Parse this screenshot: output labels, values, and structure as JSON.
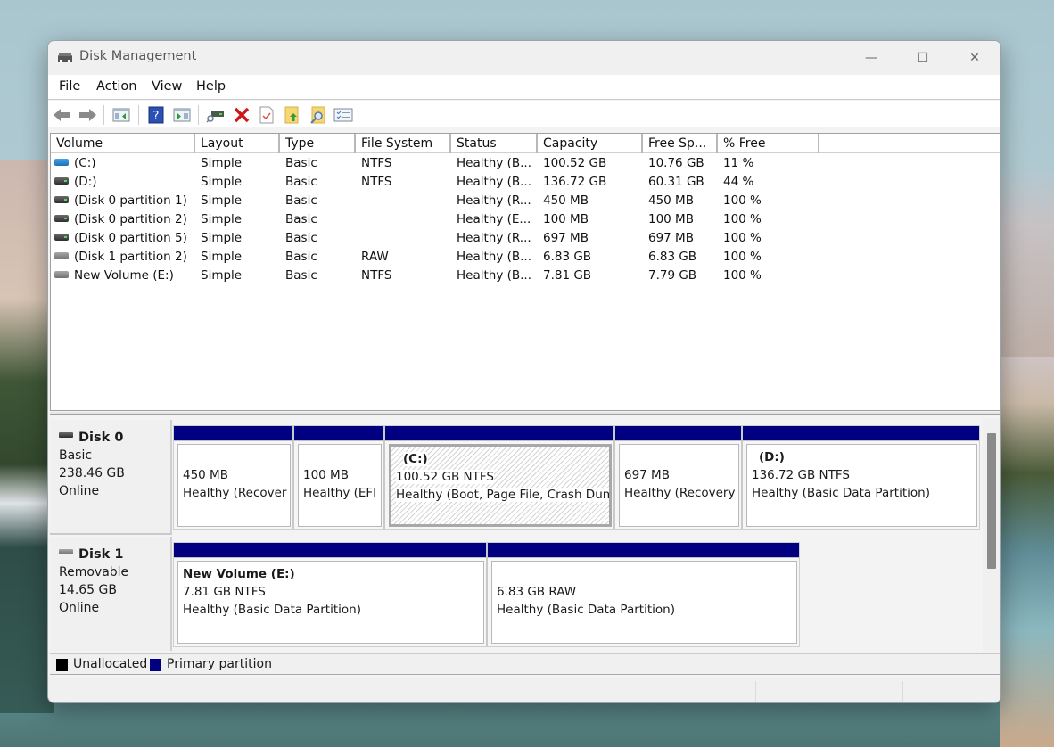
{
  "window": {
    "title": "Disk Management",
    "controls": {
      "minimize": "—",
      "maximize": "☐",
      "close": "✕"
    }
  },
  "menu": [
    "File",
    "Action",
    "View",
    "Help"
  ],
  "toolbar": [
    {
      "name": "back-icon"
    },
    {
      "name": "forward-icon"
    },
    {
      "name": "show-hide-console-tree-icon"
    },
    {
      "name": "help-icon"
    },
    {
      "name": "show-hide-action-pane-icon"
    },
    {
      "name": "connect-disk-icon"
    },
    {
      "name": "delete-icon"
    },
    {
      "name": "properties-icon"
    },
    {
      "name": "open-folder-up-icon"
    },
    {
      "name": "search-folder-icon"
    },
    {
      "name": "checklist-icon"
    }
  ],
  "volume_list": {
    "columns": [
      "Volume",
      "Layout",
      "Type",
      "File System",
      "Status",
      "Capacity",
      "Free Sp...",
      "% Free"
    ],
    "rows": [
      {
        "icon": "blue",
        "volume": " (C:)",
        "layout": "Simple",
        "type": "Basic",
        "fs": "NTFS",
        "status": "Healthy (B...",
        "capacity": "100.52 GB",
        "free": "10.76 GB",
        "pct": "11 %"
      },
      {
        "icon": "dark",
        "volume": " (D:)",
        "layout": "Simple",
        "type": "Basic",
        "fs": "NTFS",
        "status": "Healthy (B...",
        "capacity": "136.72 GB",
        "free": "60.31 GB",
        "pct": "44 %"
      },
      {
        "icon": "dark",
        "volume": "(Disk 0 partition 1)",
        "layout": "Simple",
        "type": "Basic",
        "fs": "",
        "status": "Healthy (R...",
        "capacity": "450 MB",
        "free": "450 MB",
        "pct": "100 %"
      },
      {
        "icon": "dark",
        "volume": "(Disk 0 partition 2)",
        "layout": "Simple",
        "type": "Basic",
        "fs": "",
        "status": "Healthy (E...",
        "capacity": "100 MB",
        "free": "100 MB",
        "pct": "100 %"
      },
      {
        "icon": "dark",
        "volume": "(Disk 0 partition 5)",
        "layout": "Simple",
        "type": "Basic",
        "fs": "",
        "status": "Healthy (R...",
        "capacity": "697 MB",
        "free": "697 MB",
        "pct": "100 %"
      },
      {
        "icon": "grey",
        "volume": "(Disk 1 partition 2)",
        "layout": "Simple",
        "type": "Basic",
        "fs": "RAW",
        "status": "Healthy (B...",
        "capacity": "6.83 GB",
        "free": "6.83 GB",
        "pct": "100 %"
      },
      {
        "icon": "grey",
        "volume": "New Volume (E:)",
        "layout": "Simple",
        "type": "Basic",
        "fs": "NTFS",
        "status": "Healthy (B...",
        "capacity": "7.81 GB",
        "free": "7.79 GB",
        "pct": "100 %"
      }
    ]
  },
  "disks": [
    {
      "name": "Disk 0",
      "kind": "Basic",
      "size": "238.46 GB",
      "state": "Online",
      "partitions": [
        {
          "title": "",
          "size": "450 MB",
          "status": "Healthy (Recover"
        },
        {
          "title": "",
          "size": "100 MB",
          "status": "Healthy (EFI"
        },
        {
          "title": "(C:)",
          "size": "100.52 GB NTFS",
          "status": "Healthy (Boot, Page File, Crash Dum"
        },
        {
          "title": "",
          "size": "697 MB",
          "status": "Healthy (Recovery"
        },
        {
          "title": "(D:)",
          "size": "136.72 GB NTFS",
          "status": "Healthy (Basic Data Partition)"
        }
      ]
    },
    {
      "name": "Disk 1",
      "kind": "Removable",
      "size": "14.65 GB",
      "state": "Online",
      "partitions": [
        {
          "title": "New Volume  (E:)",
          "size": "7.81 GB NTFS",
          "status": "Healthy (Basic Data Partition)"
        },
        {
          "title": "",
          "size": "6.83 GB RAW",
          "status": "Healthy (Basic Data Partition)"
        }
      ]
    }
  ],
  "legend": [
    {
      "label": "Unallocated",
      "color": "#000000"
    },
    {
      "label": "Primary partition",
      "color": "#000080"
    }
  ],
  "colors": {
    "primary_partition": "#000080",
    "unallocated": "#000000"
  }
}
